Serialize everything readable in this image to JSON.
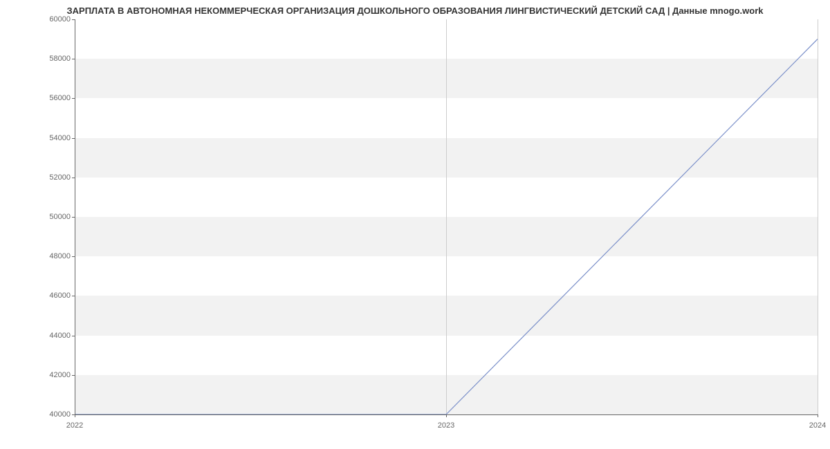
{
  "chart_data": {
    "type": "line",
    "title": "ЗАРПЛАТА В АВТОНОМНАЯ НЕКОММЕРЧЕСКАЯ ОРГАНИЗАЦИЯ ДОШКОЛЬНОГО ОБРАЗОВАНИЯ ЛИНГВИСТИЧЕСКИЙ ДЕТСКИЙ САД | Данные mnogo.work",
    "x": [
      2022,
      2023,
      2024
    ],
    "values": [
      40000,
      40000,
      59000
    ],
    "x_ticks": [
      2022,
      2023,
      2024
    ],
    "y_ticks": [
      40000,
      42000,
      44000,
      46000,
      48000,
      50000,
      52000,
      54000,
      56000,
      58000,
      60000
    ],
    "xlim": [
      2022,
      2024
    ],
    "ylim": [
      40000,
      60000
    ],
    "line_color": "#7a8fc9"
  }
}
